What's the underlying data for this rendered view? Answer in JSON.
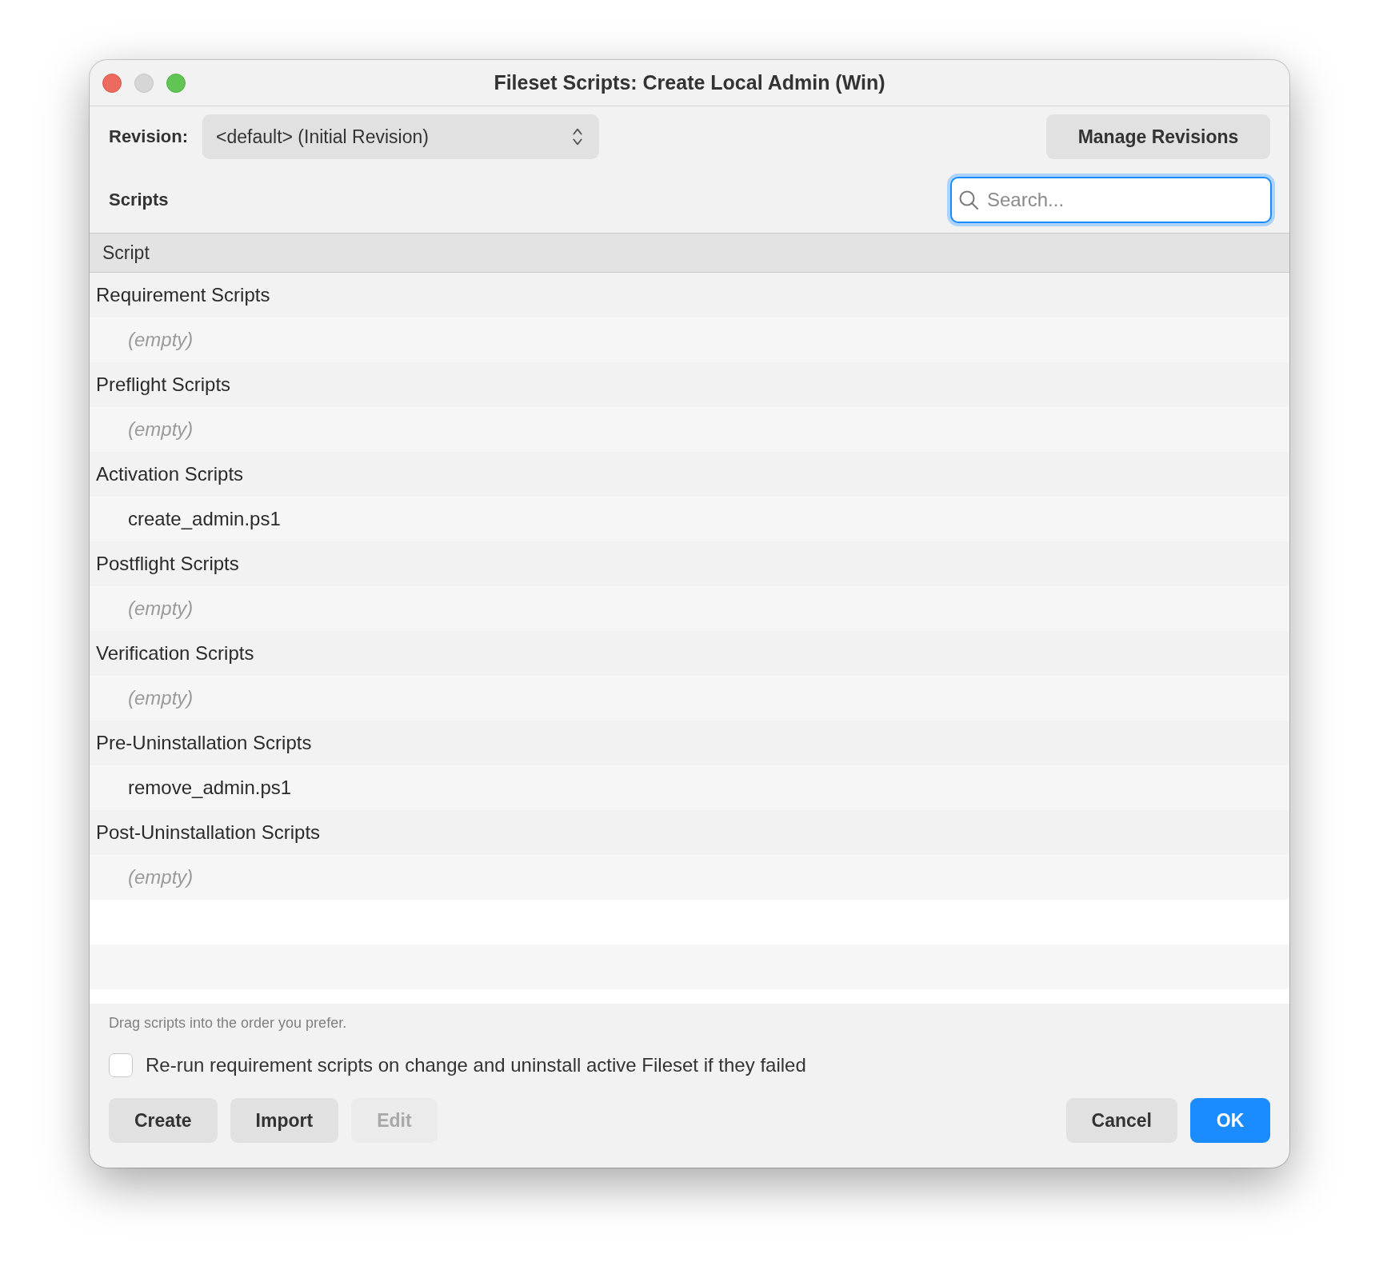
{
  "window": {
    "title": "Fileset Scripts: Create Local Admin (Win)"
  },
  "revision": {
    "label": "Revision:",
    "value": "<default> (Initial Revision)"
  },
  "manage_button": "Manage Revisions",
  "scripts_heading": "Scripts",
  "search": {
    "placeholder": "Search...",
    "focused": true
  },
  "table": {
    "columns": [
      "Script"
    ],
    "groups": [
      {
        "label": "Requirement Scripts",
        "children": [
          {
            "label": "(empty)",
            "kind": "placeholder"
          }
        ]
      },
      {
        "label": "Preflight Scripts",
        "children": [
          {
            "label": "(empty)",
            "kind": "placeholder"
          }
        ]
      },
      {
        "label": "Activation Scripts",
        "children": [
          {
            "label": "create_admin.ps1",
            "kind": "script"
          }
        ]
      },
      {
        "label": "Postflight Scripts",
        "children": [
          {
            "label": "(empty)",
            "kind": "placeholder"
          }
        ]
      },
      {
        "label": "Verification Scripts",
        "children": [
          {
            "label": "(empty)",
            "kind": "placeholder"
          }
        ]
      },
      {
        "label": "Pre-Uninstallation Scripts",
        "children": [
          {
            "label": "remove_admin.ps1",
            "kind": "script"
          }
        ]
      },
      {
        "label": "Post-Uninstallation Scripts",
        "children": [
          {
            "label": "(empty)",
            "kind": "placeholder"
          }
        ]
      }
    ]
  },
  "hint": "Drag scripts into the order you prefer.",
  "rerun_option": {
    "label": "Re-run requirement scripts on change and uninstall active Fileset if they failed",
    "checked": false
  },
  "left_buttons": [
    {
      "label": "Create",
      "disabled": false
    },
    {
      "label": "Import",
      "disabled": false
    },
    {
      "label": "Edit",
      "disabled": true
    }
  ],
  "right_buttons": [
    {
      "label": "Cancel",
      "primary": false
    },
    {
      "label": "OK",
      "primary": true
    }
  ]
}
